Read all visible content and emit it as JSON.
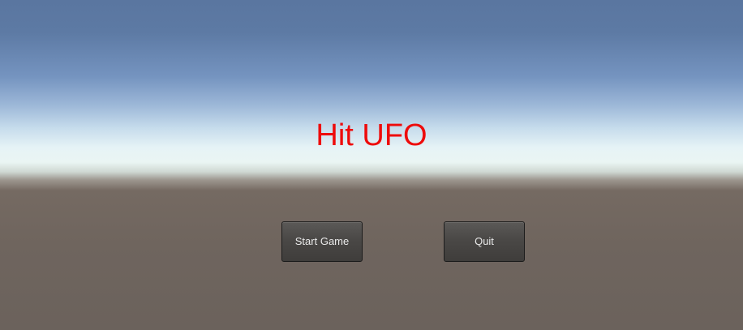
{
  "menu": {
    "title": "Hit UFO",
    "start_label": "Start Game",
    "quit_label": "Quit"
  },
  "colors": {
    "title": "#ee0b0b",
    "button_bg": "#4a4846",
    "button_text": "#e9e9e9",
    "sky_top": "#5a76a0",
    "horizon": "#eaf5f3",
    "ground": "#6b625c"
  }
}
